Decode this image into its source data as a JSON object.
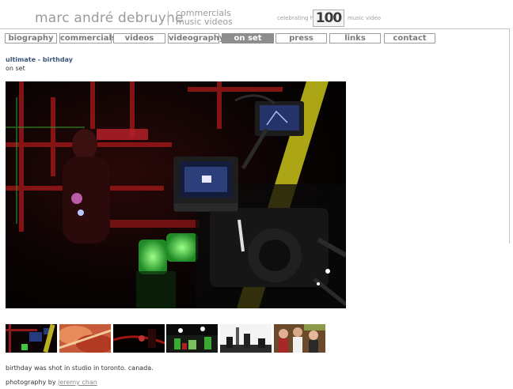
{
  "header": {
    "site_name": "marc andré debruyne",
    "category_line_1": "commercials",
    "category_line_2": "music videos",
    "celebrating_prefix": "celebrating his",
    "hundred_number": "100",
    "celebrating_suffix": "music video"
  },
  "nav": {
    "items": [
      {
        "label": "biography"
      },
      {
        "label": "commercials"
      },
      {
        "label": "videos"
      },
      {
        "label": "videography"
      },
      {
        "label": "on set"
      },
      {
        "label": "press"
      },
      {
        "label": "links"
      },
      {
        "label": "contact"
      }
    ],
    "active": "on set"
  },
  "page": {
    "title": "ultimate - birthday",
    "subtitle": "on set"
  },
  "thumbnails": [
    {
      "name": "thumb-1"
    },
    {
      "name": "thumb-2"
    },
    {
      "name": "thumb-3"
    },
    {
      "name": "thumb-4"
    },
    {
      "name": "thumb-5"
    },
    {
      "name": "thumb-6"
    }
  ],
  "caption": "birthday was shot in studio in toronto. canada.",
  "credit": {
    "prefix": "photography by",
    "name": "jeremy chan"
  },
  "colors": {
    "title": "#3b5577",
    "nav_active_bg": "#8d8d8d",
    "nav_border": "#9e9e9e",
    "muted_text": "#9a9a9a"
  }
}
